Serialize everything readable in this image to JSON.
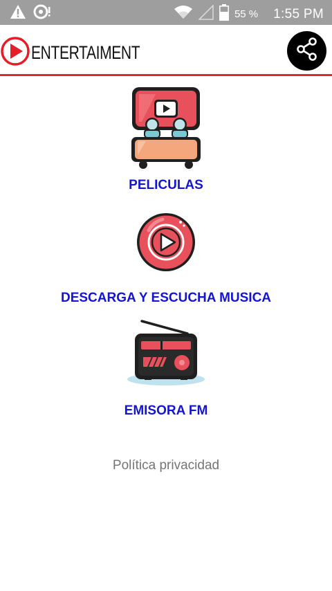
{
  "status_bar": {
    "battery_text": "55 %",
    "time": "1:55 PM",
    "icons": [
      "warning-icon",
      "sync-icon",
      "wifi-icon",
      "signal-icon",
      "battery-icon"
    ]
  },
  "app_bar": {
    "title": "ENTERTAIMENT",
    "logo_icon": "play-circle-icon",
    "share_icon": "share-icon",
    "accent_color": "#d32f2f"
  },
  "menu": [
    {
      "label": "PELICULAS",
      "icon": "cinema-icon"
    },
    {
      "label": "DESCARGA Y ESCUCHA MUSICA",
      "icon": "music-play-icon"
    },
    {
      "label": "EMISORA FM",
      "icon": "radio-icon"
    }
  ],
  "footer": {
    "privacy_link": "Política privacidad"
  },
  "colors": {
    "status_bar": "#9e9e9e",
    "label_blue": "#1414d2",
    "icon_red": "#e8505b"
  }
}
